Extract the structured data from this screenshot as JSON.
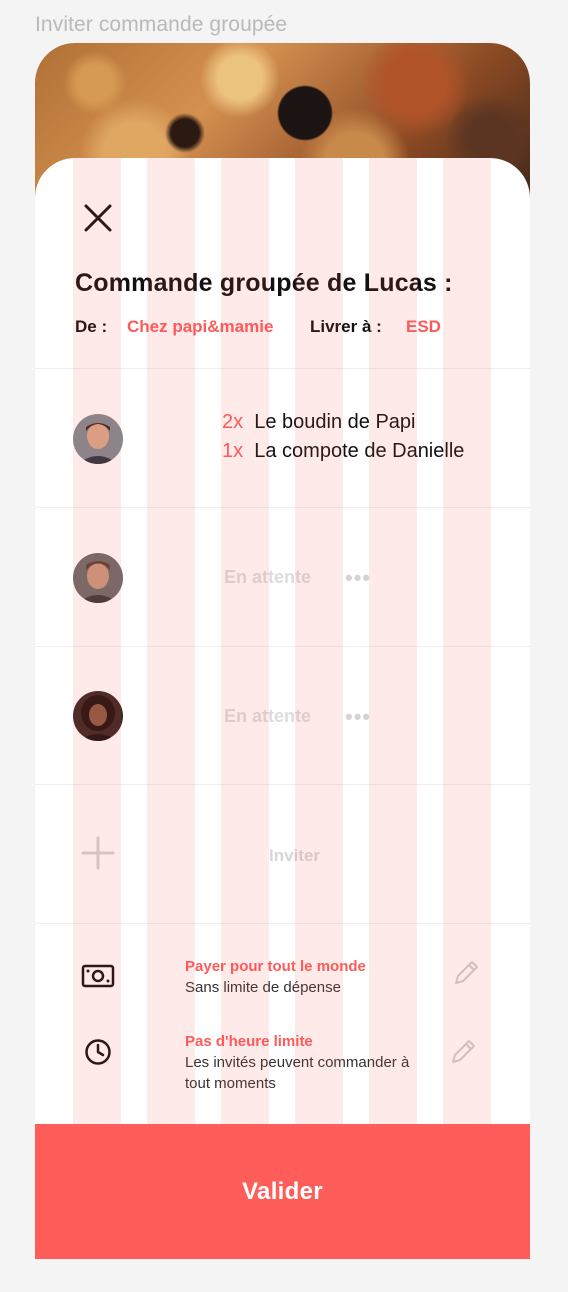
{
  "frame_label": "Inviter commande groupée",
  "header": {
    "title": "Commande groupée de Lucas :",
    "from_label": "De :",
    "from_value": "Chez papi&mamie",
    "deliver_label": "Livrer à :",
    "deliver_value": "ESD"
  },
  "participants": [
    {
      "avatar": "avatar-man-1",
      "items": [
        {
          "qty": "2x",
          "name": "Le boudin de Papi"
        },
        {
          "qty": "1x",
          "name": "La compote de Danielle"
        }
      ]
    },
    {
      "avatar": "avatar-man-2",
      "status": "En attente",
      "dots": "•••"
    },
    {
      "avatar": "avatar-woman-1",
      "status": "En attente",
      "dots": "•••"
    }
  ],
  "invite": {
    "label": "Inviter",
    "icon": "plus-icon"
  },
  "options": [
    {
      "icon": "money-icon",
      "title": "Payer pour tout le monde",
      "subtitle": "Sans limite de dépense"
    },
    {
      "icon": "clock-icon",
      "title": "Pas d'heure limite",
      "subtitle": "Les invités peuvent commander à tout moments"
    }
  ],
  "validate_label": "Valider",
  "colors": {
    "accent": "#ff5a5a",
    "button": "#ff5d5a",
    "muted": "#d7d7d7"
  }
}
